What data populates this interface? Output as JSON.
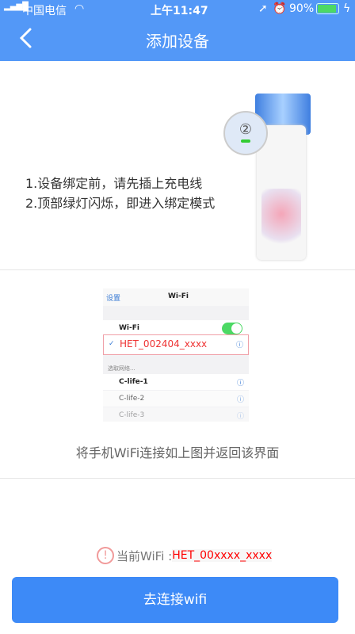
{
  "status_bar": {
    "carrier": "中国电信",
    "time": "上午11:47",
    "battery": "90%"
  },
  "nav": {
    "title": "添加设备"
  },
  "steps": [
    "1.设备绑定前，请先插上充电线",
    "2.顶部绿灯闪烁，即进入绑定模式"
  ],
  "illustration": {
    "badge": "②"
  },
  "wifi_screenshot": {
    "back_label": "设置",
    "title": "Wi-Fi",
    "wifi_label": "Wi-Fi",
    "selected_network": "HET_002404_xxxx",
    "choosing_label": "选取网络...",
    "networks": [
      "C-life-1",
      "C-life-2",
      "C-life-3"
    ]
  },
  "caption": "将手机WiFi连接如上图并返回该界面",
  "current_wifi": {
    "label": "当前WiFi :",
    "ssid": "HET_00xxxx_xxxx"
  },
  "connect_button": "去连接wifi"
}
